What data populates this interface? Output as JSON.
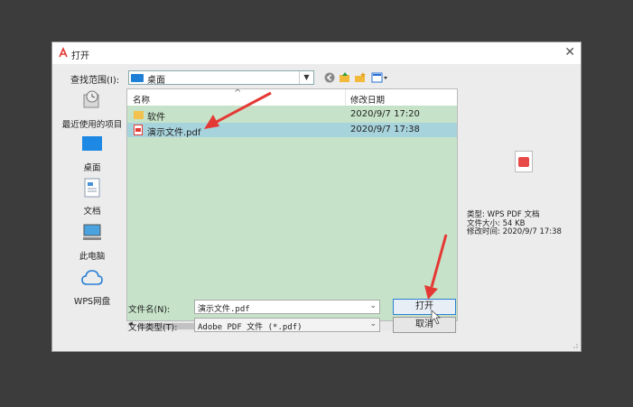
{
  "dialog": {
    "title": "打开",
    "close_glyph": "✕"
  },
  "toolbar": {
    "look_in_label": "查找范围(I):",
    "look_in_value": "桌面"
  },
  "places": [
    {
      "label": "最近使用的项目",
      "icon": "recent-icon"
    },
    {
      "label": "桌面",
      "icon": "desktop-icon"
    },
    {
      "label": "文档",
      "icon": "documents-icon"
    },
    {
      "label": "此电脑",
      "icon": "computer-icon"
    },
    {
      "label": "WPS网盘",
      "icon": "cloud-icon"
    }
  ],
  "list": {
    "col_name": "名称",
    "col_date": "修改日期",
    "rows": [
      {
        "name": "软件",
        "date": "2020/9/7 17:20",
        "type": "folder",
        "selected": false
      },
      {
        "name": "演示文件.pdf",
        "date": "2020/9/7 17:38",
        "type": "pdf",
        "selected": true
      }
    ]
  },
  "preview_info": {
    "type_line": "类型: WPS PDF 文档",
    "size_line": "文件大小: 54 KB",
    "modified_line": "修改时间: 2020/9/7 17:38"
  },
  "form": {
    "filename_label": "文件名(N):",
    "filename_value": "演示文件.pdf",
    "filetype_label": "文件类型(T):",
    "filetype_value": "Adobe PDF 文件 (*.pdf)"
  },
  "buttons": {
    "open": "打开",
    "cancel": "取消"
  },
  "colors": {
    "list_bg": "#c6e3c9",
    "selected_row": "#a7d3dc",
    "annotation_arrow": "#e53935"
  }
}
